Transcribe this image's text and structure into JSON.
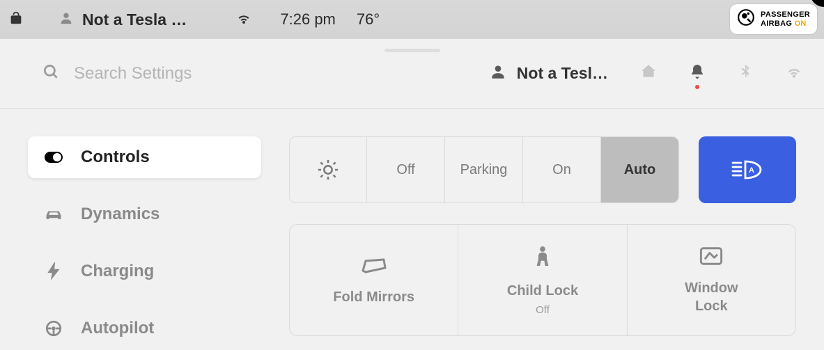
{
  "status": {
    "profile_name": "Not a Tesla …",
    "time": "7:26 pm",
    "temperature": "76°",
    "airbag_line1": "PASSENGER",
    "airbag_line2_prefix": "AIRBAG ",
    "airbag_line2_status": "ON"
  },
  "header": {
    "search_placeholder": "Search Settings",
    "profile_name": "Not a Tesl…"
  },
  "sidebar": {
    "items": [
      {
        "label": "Controls"
      },
      {
        "label": "Dynamics"
      },
      {
        "label": "Charging"
      },
      {
        "label": "Autopilot"
      }
    ]
  },
  "lights": {
    "options": [
      "Off",
      "Parking",
      "On",
      "Auto"
    ],
    "selected": "Auto"
  },
  "cards": {
    "fold_mirrors": {
      "label": "Fold Mirrors"
    },
    "child_lock": {
      "label": "Child Lock",
      "sub": "Off"
    },
    "window_lock": {
      "label": "Window\nLock"
    }
  },
  "colors": {
    "accent": "#3a5fe0",
    "airbag_on": "#f5a300"
  }
}
